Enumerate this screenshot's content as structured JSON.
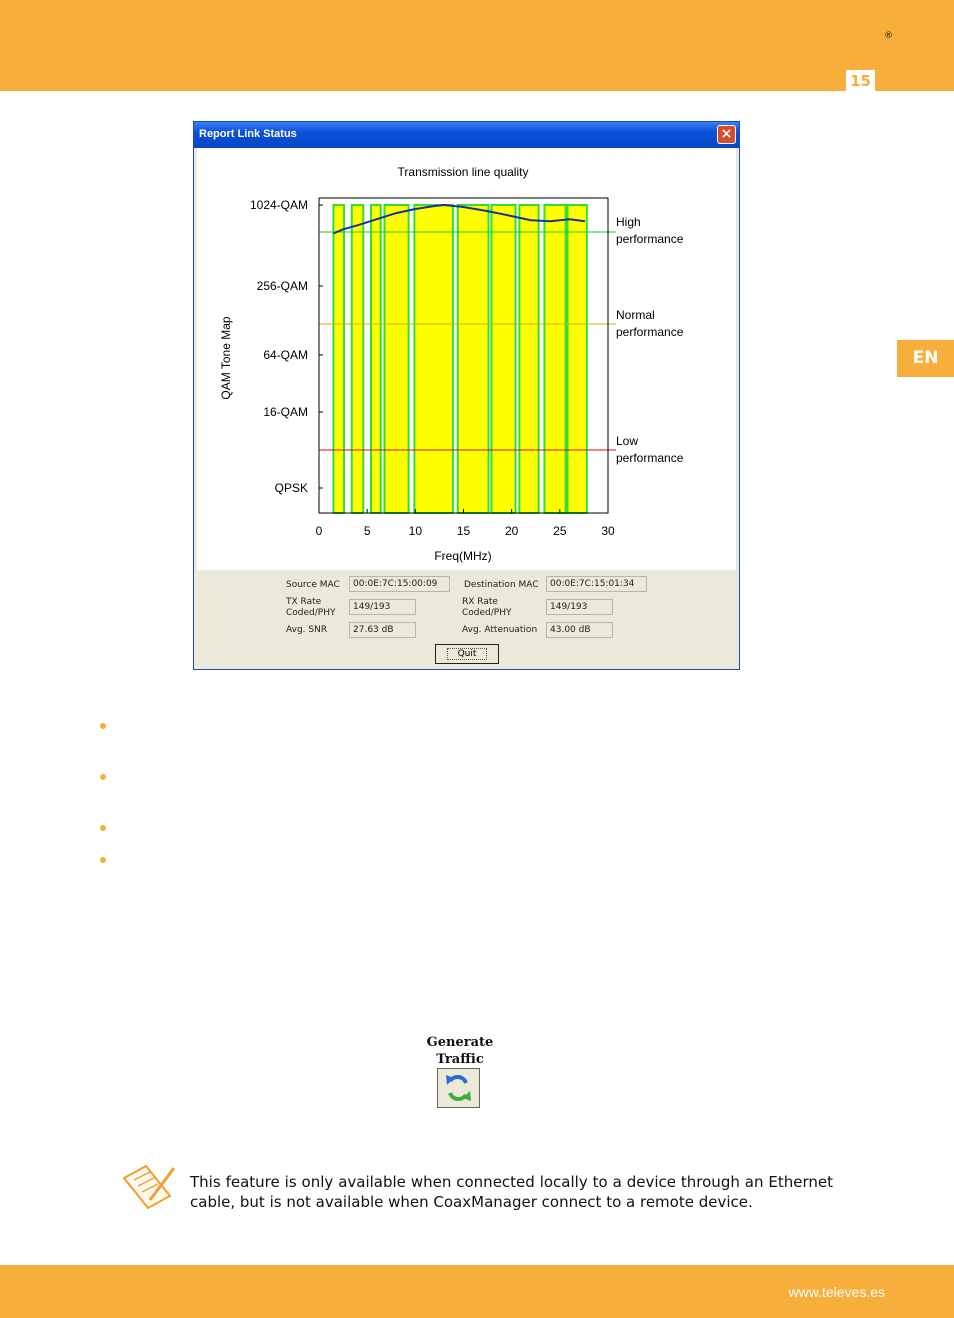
{
  "page": {
    "registered_mark": "®",
    "page_number": "15",
    "language_tab": "EN",
    "footer_url": "www.televes.es"
  },
  "dialog": {
    "title": "Report Link Status",
    "close_symbol": "×",
    "fields": {
      "source_mac_label": "Source MAC",
      "source_mac_value": "00:0E:7C:15:00:09",
      "destination_mac_label": "Destination MAC",
      "destination_mac_value": "00:0E:7C:15:01:34",
      "tx_rate_label_line1": "TX Rate",
      "tx_rate_label_line2": "Coded/PHY",
      "tx_rate_value": "149/193",
      "rx_rate_label_line1": "RX Rate",
      "rx_rate_label_line2": "Coded/PHY",
      "rx_rate_value": "149/193",
      "avg_snr_label": "Avg. SNR",
      "avg_snr_value": "27.63 dB",
      "avg_attenuation_label": "Avg. Attenuation",
      "avg_attenuation_value": "43.00 dB"
    },
    "quit_label": "Quit"
  },
  "chart_data": {
    "type": "bar",
    "title": "Transmission line quality",
    "xlabel": "Freq(MHz)",
    "ylabel": "QAM Tone Map",
    "xlim": [
      0,
      30
    ],
    "x_ticks": [
      "0",
      "5",
      "10",
      "15",
      "20",
      "25",
      "30"
    ],
    "y_levels": [
      "QPSK",
      "16-QAM",
      "64-QAM",
      "256-QAM",
      "1024-QAM"
    ],
    "bands": [
      [
        1.5,
        2.6
      ],
      [
        3.4,
        4.6
      ],
      [
        5.4,
        6.4
      ],
      [
        6.8,
        9.3
      ],
      [
        9.9,
        13.9
      ],
      [
        14.4,
        17.6
      ],
      [
        17.9,
        20.4
      ],
      [
        20.8,
        22.8
      ],
      [
        23.4,
        25.6
      ],
      [
        25.8,
        27.8
      ]
    ],
    "snr_curve": [
      [
        1.5,
        8.6
      ],
      [
        2.5,
        8.8
      ],
      [
        4,
        9.0
      ],
      [
        6,
        9.3
      ],
      [
        8,
        9.6
      ],
      [
        10,
        9.8
      ],
      [
        12,
        9.95
      ],
      [
        13,
        10.0
      ],
      [
        15,
        9.9
      ],
      [
        17.5,
        9.7
      ],
      [
        20,
        9.45
      ],
      [
        22,
        9.25
      ],
      [
        24,
        9.2
      ],
      [
        26,
        9.3
      ],
      [
        27.6,
        9.2
      ]
    ],
    "threshold_lines": [
      {
        "label_line1": "High",
        "label_line2": "performance",
        "color": "#22cc22"
      },
      {
        "label_line1": "Normal",
        "label_line2": "performance",
        "color": "#e0a800"
      },
      {
        "label_line1": "Low",
        "label_line2": "performance",
        "color": "#dd1111"
      }
    ]
  },
  "generate_traffic": {
    "label_line1": "Generate",
    "label_line2": "Traffic",
    "icon": "refresh-arrows-icon"
  },
  "note": {
    "text": "This feature is only available when connected locally to a device through an Ethernet cable, but is not available when CoaxManager connect to a remote device.",
    "icon": "note-pencil-icon"
  }
}
